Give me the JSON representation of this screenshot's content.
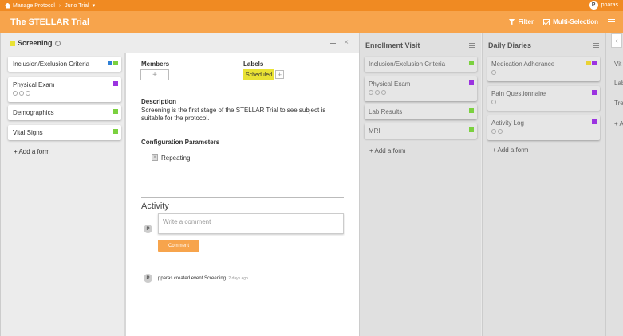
{
  "topbar": {
    "breadcrumb": [
      "Manage Protocol",
      "Juno Trial"
    ],
    "separator": "›",
    "dropdown": "▾",
    "user": {
      "initial": "P",
      "name": "pparas"
    }
  },
  "header": {
    "title": "The STELLAR Trial",
    "filter_label": "Filter",
    "multiselect_label": "Multi-Selection"
  },
  "active_list": {
    "title": "Screening",
    "forms": [
      {
        "label": "Inclusion/Exclusion Criteria",
        "colors": [
          "#2f80d6",
          "#7bd13f"
        ]
      },
      {
        "label": "Physical Exam",
        "colors": [
          "#9b33e0"
        ],
        "badges": 3
      },
      {
        "label": "Demographics",
        "colors": [
          "#7bd13f"
        ]
      },
      {
        "label": "Vital Signs",
        "colors": [
          "#7bd13f"
        ]
      }
    ],
    "add_form": "+ Add a form"
  },
  "detail": {
    "members_label": "Members",
    "members_add": "+",
    "labels_label": "Labels",
    "label_value": "Scheduled",
    "label_add": "+",
    "description_label": "Description",
    "description": "Screening is the first stage of the STELLAR Trial to see subject is suitable for the protocol.",
    "config_label": "Configuration Parameters",
    "repeating_label": "Repeating",
    "activity_label": "Activity",
    "comment_placeholder": "Write a comment",
    "comment_button": "Comment",
    "log_avatar": "P",
    "log_text": "pparas created event Screening.",
    "log_time": "2 days ago"
  },
  "lists": [
    {
      "title": "Enrollment Visit",
      "forms": [
        {
          "label": "Inclusion/Exclusion Criteria",
          "colors": [
            "#7bd13f"
          ]
        },
        {
          "label": "Physical Exam",
          "colors": [
            "#9b33e0"
          ],
          "badges": 3
        },
        {
          "label": "Lab Results",
          "colors": [
            "#7bd13f"
          ]
        },
        {
          "label": "MRI",
          "colors": [
            "#7bd13f"
          ]
        }
      ],
      "add_form": "+ Add a form"
    },
    {
      "title": "Daily Diaries",
      "forms": [
        {
          "label": "Medication Adherance",
          "colors": [
            "#e9d234",
            "#9b33e0"
          ],
          "badges": 1
        },
        {
          "label": "Pain Questionnaire",
          "colors": [
            "#9b33e0"
          ],
          "badges": 1
        },
        {
          "label": "Activity Log",
          "colors": [
            "#9b33e0"
          ],
          "badges": 2
        }
      ],
      "add_form": "+ Add a form"
    }
  ],
  "peek_list": {
    "collapse_icon": "‹",
    "items": [
      "Vit",
      "Lab",
      "Tre",
      "+ A"
    ]
  }
}
